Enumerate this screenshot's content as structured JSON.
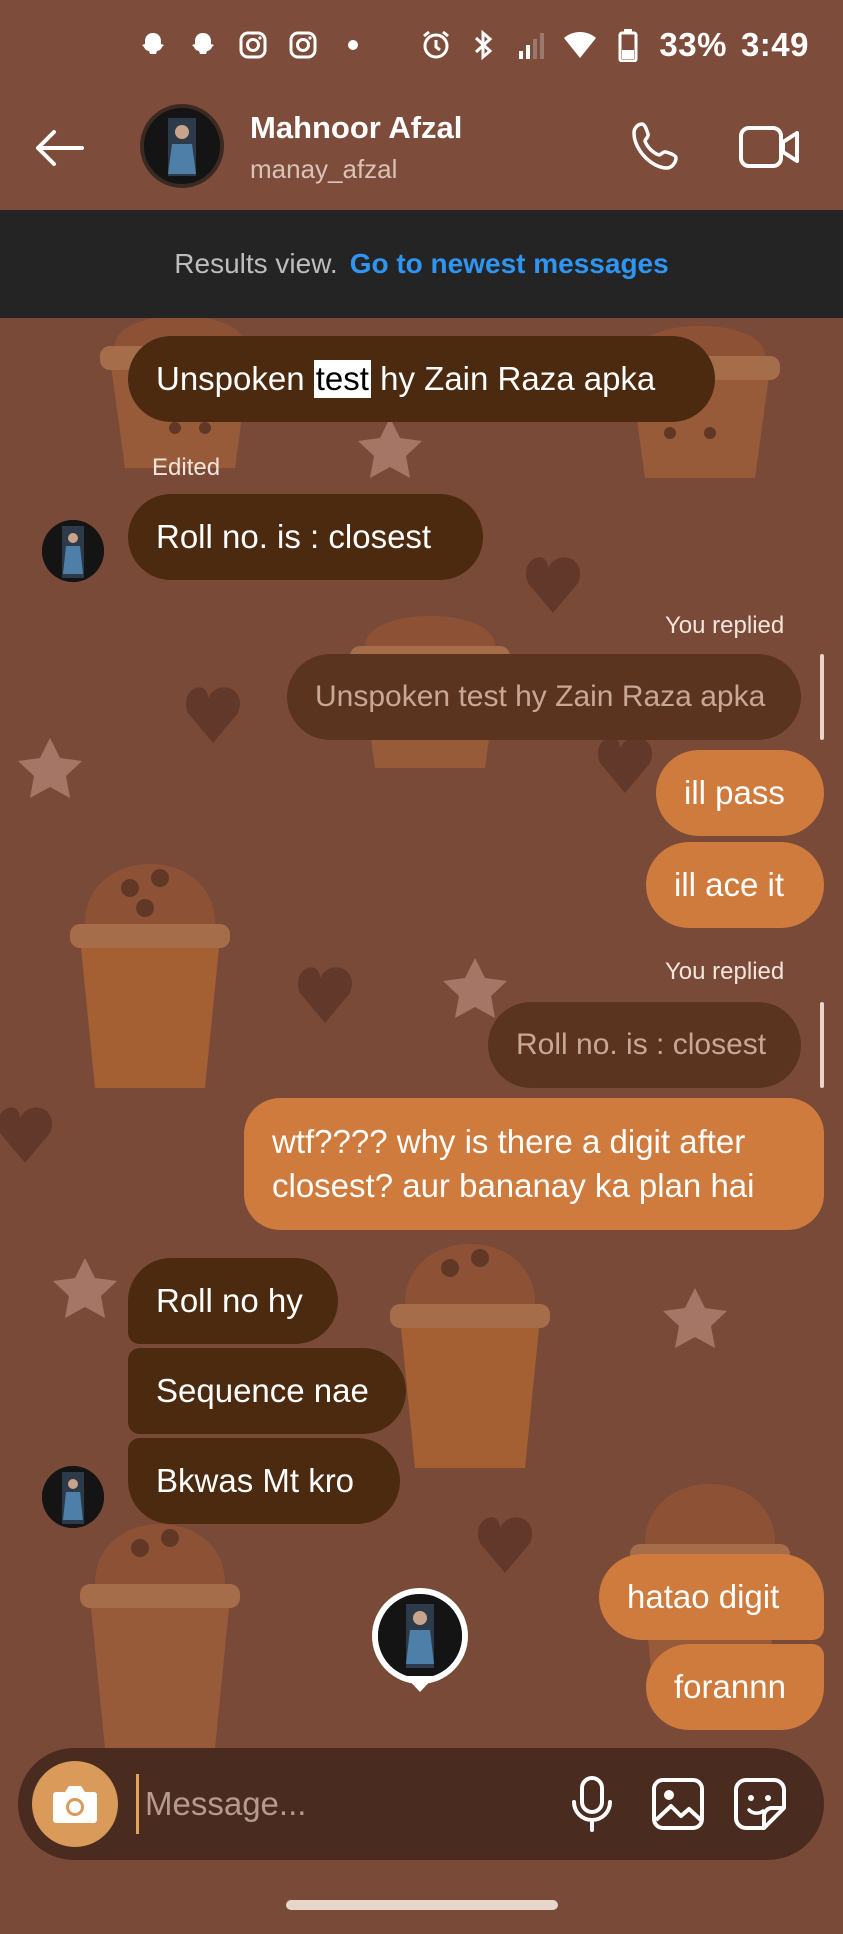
{
  "status_bar": {
    "battery": "33%",
    "time": "3:49",
    "left_icons": [
      "snapchat-icon",
      "snapchat-icon",
      "instagram-icon",
      "instagram-icon",
      "dot-icon"
    ],
    "right_icons": [
      "alarm-icon",
      "bluetooth-icon",
      "signal-icon",
      "wifi-icon",
      "battery-icon"
    ]
  },
  "header": {
    "name": "Mahnoor Afzal",
    "username": "manay_afzal"
  },
  "results": {
    "label": "Results view.",
    "link": "Go to newest messages"
  },
  "messages": {
    "m1_pre": "Unspoken ",
    "m1_highlight": "test",
    "m1_post": " hy Zain Raza apka",
    "edited": "Edited",
    "m2": "Roll no. is : closest",
    "you_replied_1": "You replied",
    "reply_quote_1": "Unspoken test hy Zain Raza apka",
    "m3": "ill pass",
    "m4": "ill ace it",
    "you_replied_2": "You replied",
    "reply_quote_2": "Roll no. is : closest",
    "m5_line1": "wtf???? why is there a digit after",
    "m5_line2": "closest? aur bananay ka plan hai",
    "m6": "Roll no hy",
    "m7": "Sequence nae",
    "m8": "Bkwas Mt kro",
    "m9": "hatao digit",
    "m10": "forannn"
  },
  "composer": {
    "placeholder": "Message..."
  },
  "colors": {
    "background": "#7a4a38",
    "incoming_bubble": "#4b2a0f",
    "outgoing_bubble": "#cf7b3d",
    "link": "#2f95f2"
  }
}
